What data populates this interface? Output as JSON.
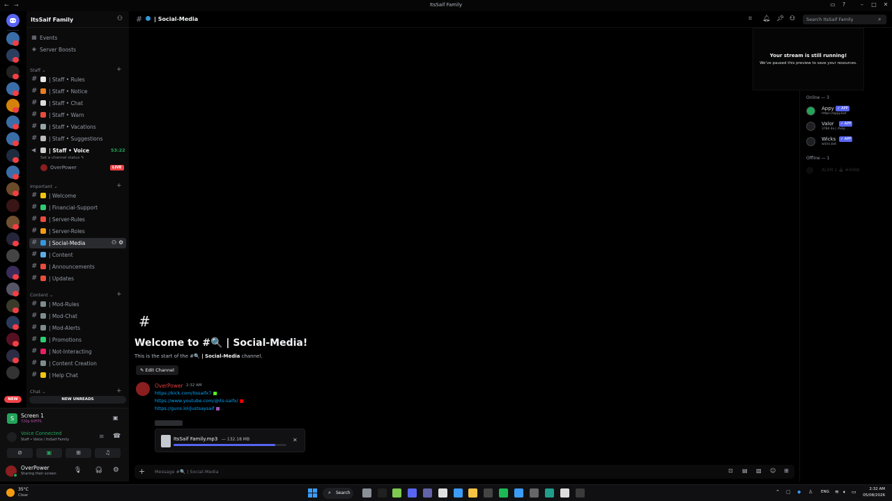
{
  "window": {
    "title": "ItsSaif Family"
  },
  "server": {
    "name": "ItsSaif Family",
    "top_items": [
      {
        "icon": "calendar-icon",
        "label": "Events"
      },
      {
        "icon": "boost-icon",
        "label": "Server Boosts"
      }
    ]
  },
  "categories": {
    "staff": "Staff",
    "important": "Important",
    "content": "Content",
    "chat": "Chat"
  },
  "channels_staff": [
    {
      "emoji": "#e8e8e8",
      "label": "| Staff • Rules"
    },
    {
      "emoji": "#e67e22",
      "label": "| Staff • Notice"
    },
    {
      "emoji": "#dddddd",
      "label": "| Staff • Chat"
    },
    {
      "emoji": "#e74c3c",
      "label": "| Staff • Warn"
    },
    {
      "emoji": "#95a5a6",
      "label": "| Staff • Vacations"
    },
    {
      "emoji": "#bbbbbb",
      "label": "| Staff • Suggestions"
    }
  ],
  "voice_channel": {
    "label": "| Staff • Voice",
    "timer": "53:22",
    "status_hint": "Set a channel status",
    "member": "OverPower",
    "live": "LIVE"
  },
  "channels_important": [
    {
      "emoji": "#f1c40f",
      "label": "| Welcome"
    },
    {
      "emoji": "#2ecc71",
      "label": "| Financial-Support"
    },
    {
      "emoji": "#e74c3c",
      "label": "| Server-Rules"
    },
    {
      "emoji": "#f39c12",
      "label": "| Server-Roles"
    },
    {
      "emoji": "#3498db",
      "label": "| Social-Media"
    },
    {
      "emoji": "#5dade2",
      "label": "| Content"
    },
    {
      "emoji": "#e74c3c",
      "label": "| Announcements"
    },
    {
      "emoji": "#e74c3c",
      "label": "| Updates"
    }
  ],
  "channels_content": [
    {
      "emoji": "#7f8c8d",
      "label": "| Mod-Rules"
    },
    {
      "emoji": "#7f8c8d",
      "label": "| Mod-Chat"
    },
    {
      "emoji": "#7f8c8d",
      "label": "| Mod-Alerts"
    },
    {
      "emoji": "#2ecc71",
      "label": "| Promotions"
    },
    {
      "emoji": "#e91e63",
      "label": "| Not-Interacting"
    },
    {
      "emoji": "#7f8c8d",
      "label": "| Content Creation"
    },
    {
      "emoji": "#f1c40f",
      "label": "| Help Chat"
    }
  ],
  "new_unreads": "NEW UNREADS",
  "stream_tile": {
    "title": "Screen 1",
    "sub": "720p 60FPS"
  },
  "voice_panel": {
    "status": "Voice Connected",
    "location": "Staff • Voice / ItsSaif Family"
  },
  "user": {
    "name": "OverPower",
    "status": "Sharing their screen"
  },
  "channel_header": {
    "name": "| Social-Media",
    "search_placeholder": "Search ItsSaif Family"
  },
  "welcome": {
    "title": "Welcome to #🔍 | Social-Media!",
    "subtitle_prefix": "This is the start of the #🔍",
    "subtitle_channel": "| Social-Media",
    "subtitle_suffix": "channel.",
    "edit_button": "Edit Channel"
  },
  "message": {
    "author": "OverPower",
    "time": "2:32 AM",
    "links": [
      "https://kick.com/itssaifx7",
      "https://www.youtube.com/@its-saifx/",
      "https://guns.lol/justsaysaif"
    ],
    "upload": {
      "file": "ItsSaif Family.mp3",
      "size": "— 132.18 MB",
      "progress": 0.9
    }
  },
  "composer_placeholder": "Message #🔍 | Social-Media",
  "stream_popup": {
    "title": "Your stream is still running!",
    "text": "We've paused this preview to save your resources."
  },
  "members": {
    "online_header": "Online — 3",
    "online": [
      {
        "name": "Appy",
        "tag": "✓ APP",
        "sub": "https://appy.bot"
      },
      {
        "name": "Valor",
        "tag": "✓ APP",
        "sub": "3784 4e | /help ..."
      },
      {
        "name": "Wicks",
        "tag": "✓ APP",
        "sub": "wicks.bot"
      }
    ],
    "offline_header": "Offline — 1",
    "offline": [
      {
        "name": "ALSM 1 🕹 #4068"
      }
    ]
  },
  "taskbar": {
    "weather_temp": "35°C",
    "weather_text": "Clear",
    "search": "Search",
    "lang": "ENG",
    "time": "2:32 AM",
    "date": "05/08/2026"
  },
  "colors": {
    "accent": "#5865f2",
    "live": "#ed4245",
    "link": "#00a8fc",
    "voice_green": "#23a55a",
    "author": "#e03c3c"
  }
}
